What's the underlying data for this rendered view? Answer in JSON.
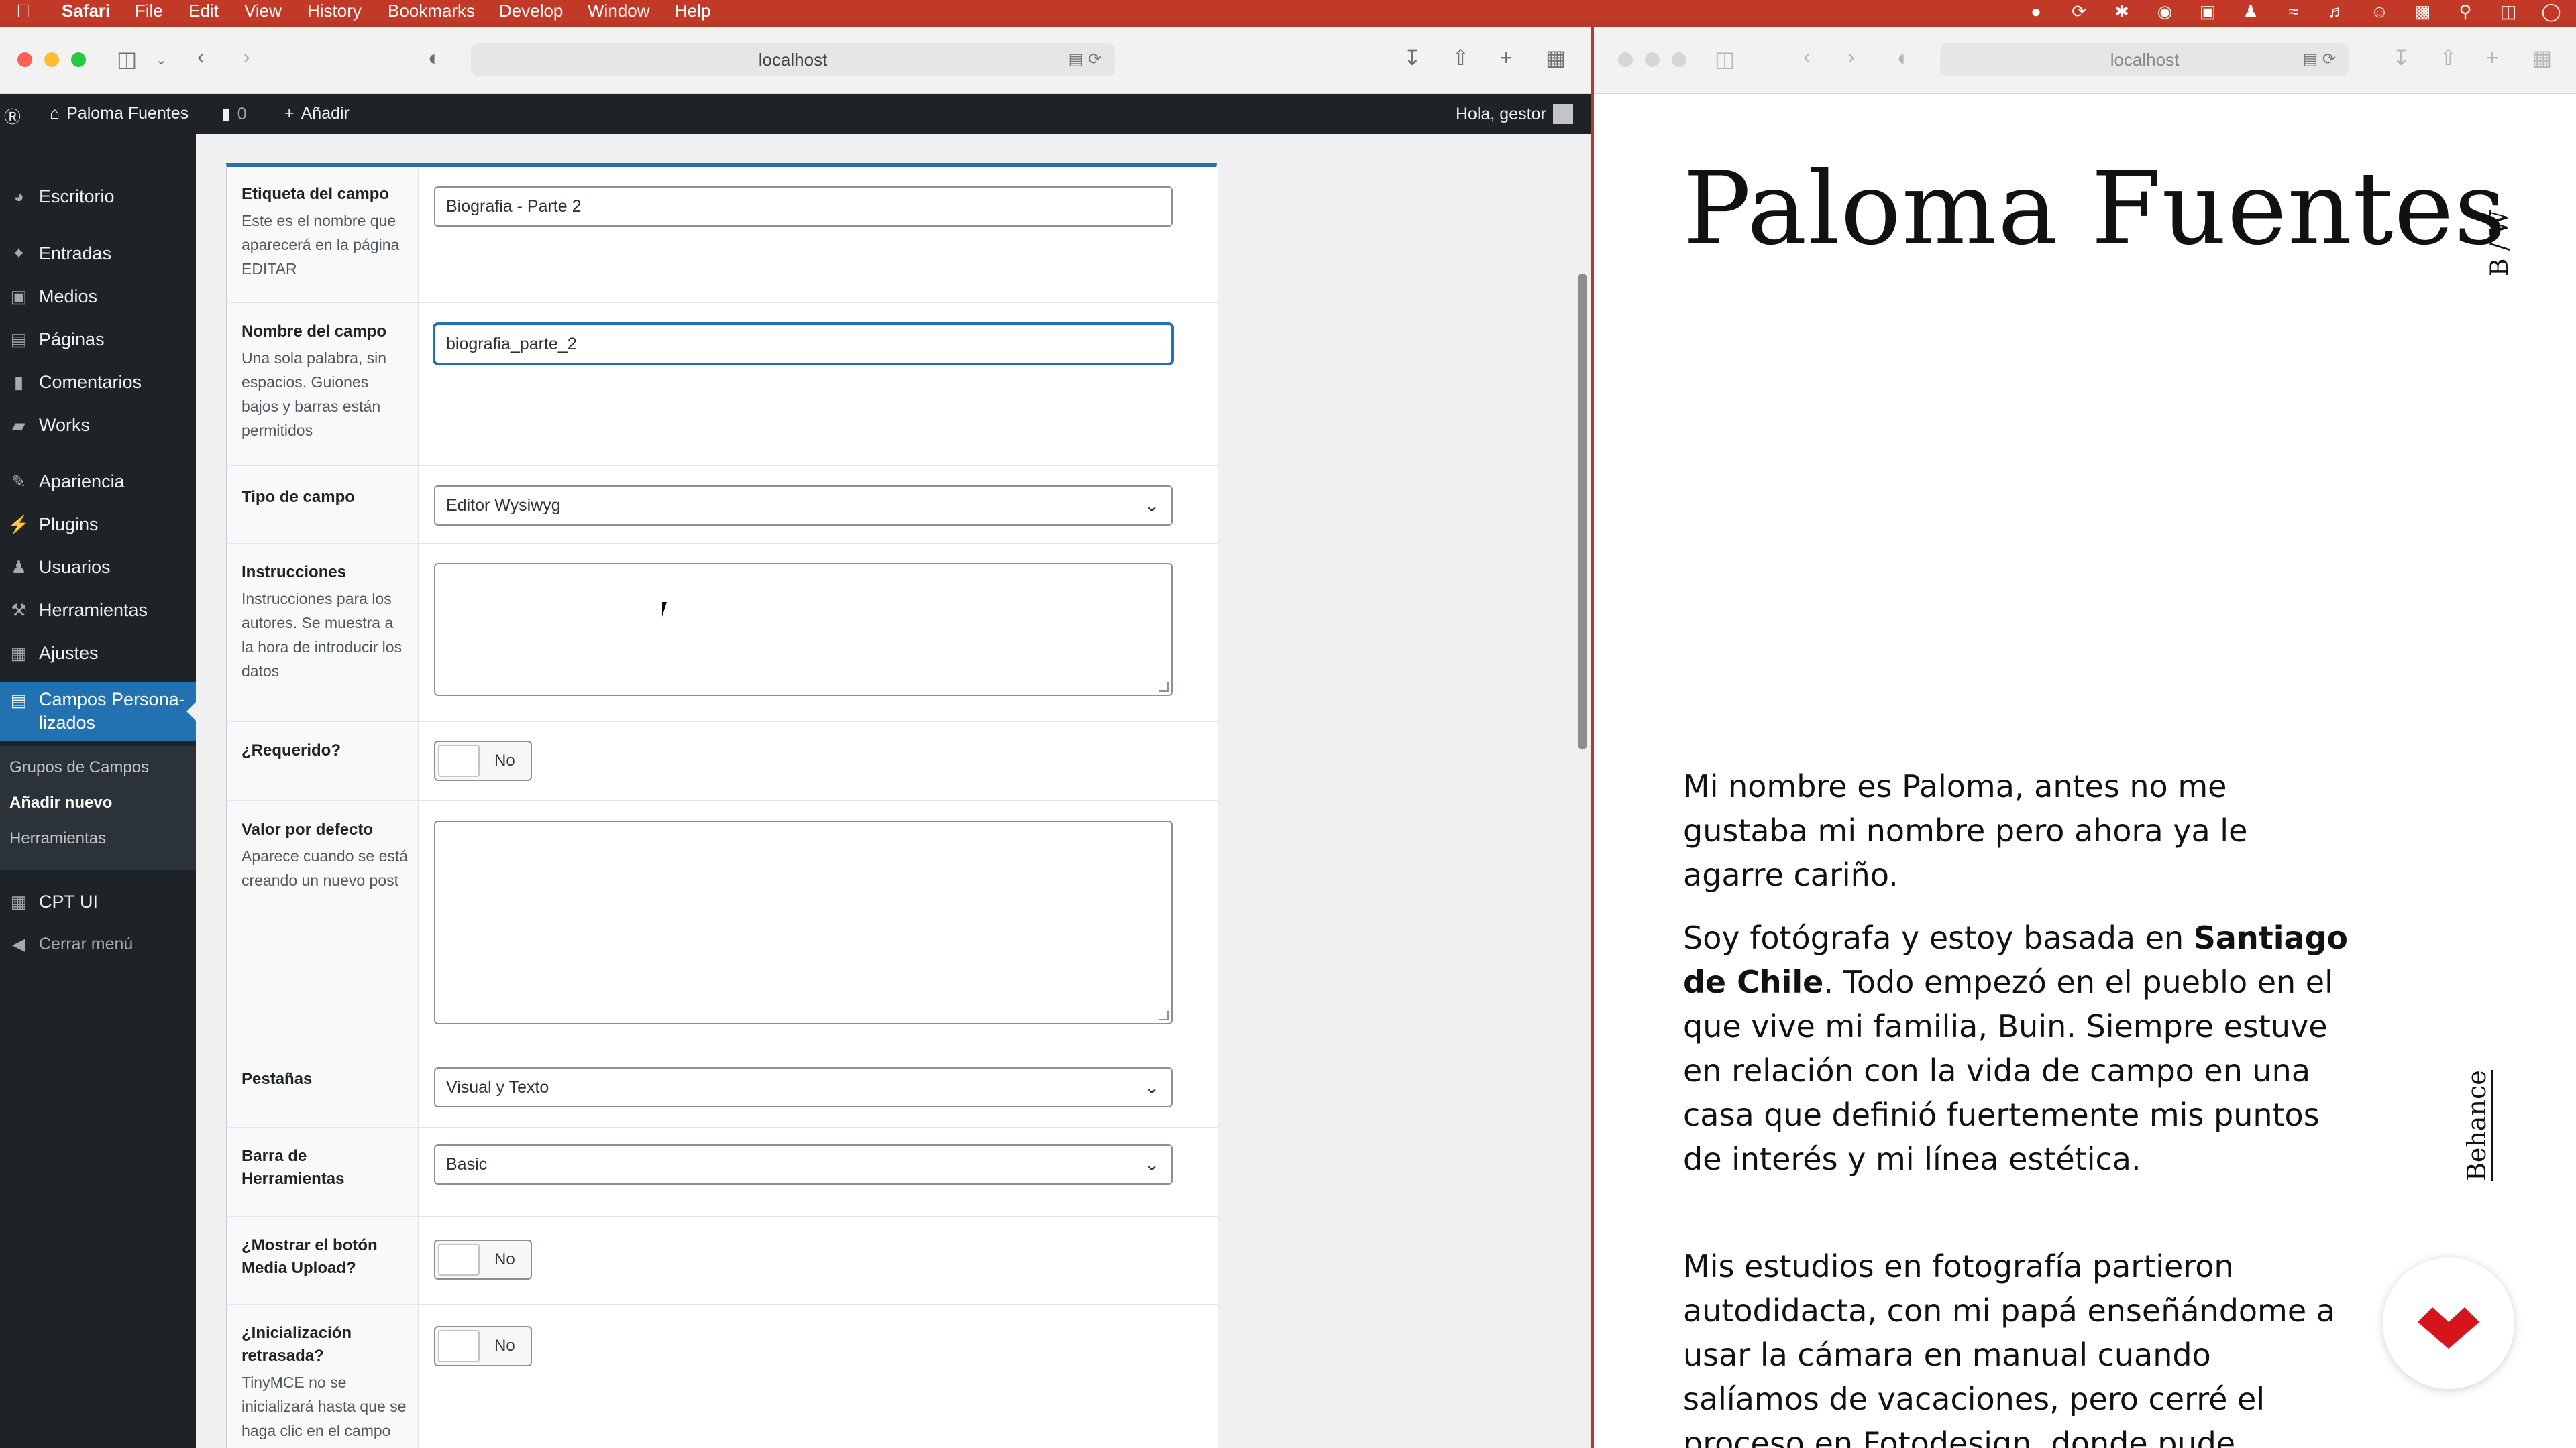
{
  "menubar": {
    "app": "Safari",
    "items": [
      "File",
      "Edit",
      "View",
      "History",
      "Bookmarks",
      "Develop",
      "Window",
      "Help"
    ]
  },
  "left_browser": {
    "url": "localhost"
  },
  "right_browser": {
    "url": "localhost"
  },
  "admin_bar": {
    "site_name": "Paloma Fuentes",
    "comments_count": "0",
    "add_new": "Añadir",
    "greeting": "Hola, gestor"
  },
  "sidebar": {
    "items": [
      "Escritorio",
      "Entradas",
      "Medios",
      "Páginas",
      "Comentarios",
      "Works",
      "Apariencia",
      "Plugins",
      "Usuarios",
      "Herramientas",
      "Ajustes"
    ],
    "active_line1": "Campos Persona-",
    "active_line2": "lizados",
    "submenu": [
      "Grupos de Campos",
      "Añadir nuevo",
      "Herramientas"
    ],
    "cpt": "CPT UI",
    "collapse": "Cerrar menú"
  },
  "form": {
    "field_label": {
      "title": "Etiqueta del campo",
      "desc": "Este es el nombre que aparecerá en la página EDITAR",
      "value": "Biografia - Parte 2"
    },
    "field_name": {
      "title": "Nombre del campo",
      "desc": "Una sola palabra, sin espacios. Guiones bajos y barras están permitidos",
      "value": "biografia_parte_2"
    },
    "field_type": {
      "title": "Tipo de campo",
      "value": "Editor Wysiwyg"
    },
    "instructions": {
      "title": "Instrucciones",
      "desc": "Instrucciones para los autores. Se muestra a la hora de introducir los datos"
    },
    "required": {
      "title": "¿Requerido?",
      "value": "No"
    },
    "default_value": {
      "title": "Valor por defecto",
      "desc": "Aparece cuando se está creando un nuevo post"
    },
    "tabs": {
      "title": "Pestañas",
      "value": "Visual y Texto"
    },
    "toolbar": {
      "title": "Barra de Herramientas",
      "value": "Basic"
    },
    "media_upload": {
      "title": "¿Mostrar el botón Media Upload?",
      "value": "No"
    },
    "delay": {
      "title": "¿Inicialización retrasada?",
      "desc": "TinyMCE no se inicializará hasta que se haga clic en el campo",
      "value": "No"
    }
  },
  "site": {
    "title": "Paloma Fuentes",
    "side_logo": "B / W",
    "side_link": "Behance",
    "p1": "Mi nombre es Paloma, antes no me gustaba mi nombre pero ahora ya le agarre cariño.",
    "p2_a": "Soy fotógrafa y estoy basada en ",
    "p2_bold": "Santiago de Chile",
    "p2_b": ". Todo empezó en el pueblo en el que vive mi familia, Buin. Siempre estuve en relación con la vida de campo en una casa que definió fuertemente mis puntos de interés y mi línea estética.",
    "p3": "Mis estudios en fotografía partieron autodidacta, con mi papá enseñándome a usar la cámara en manual cuando salíamos de vacaciones, pero cerré el proceso en Fotodesign, donde pude especializarme en"
  },
  "colors": {
    "wp_blue": "#2271b1",
    "admin_dark": "#1d2327",
    "menubar": "#c23a27",
    "behance_red": "#d6141b"
  }
}
